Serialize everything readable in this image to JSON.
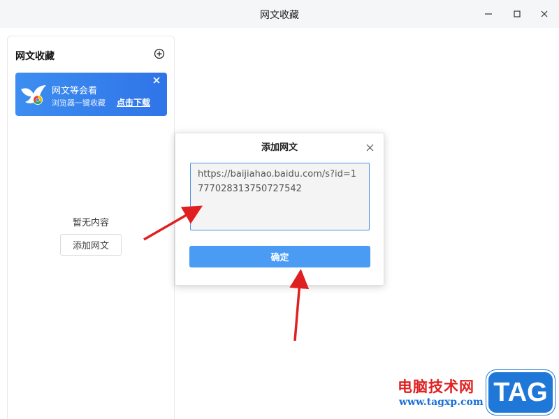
{
  "window": {
    "title": "网文收藏"
  },
  "sidebar": {
    "header": "网文收藏",
    "add_icon": "plus-circle-icon",
    "banner": {
      "title": "网文等会看",
      "subtitle": "浏览器一键收藏",
      "link": "点击下载"
    },
    "empty_text": "暂无内容",
    "add_button": "添加网文"
  },
  "dialog": {
    "title": "添加网文",
    "url_value": "https://baijiahao.baidu.com/s?id=1777028313750727542",
    "confirm_button": "确定"
  },
  "watermark": {
    "site_name": "电脑技术网",
    "url": "www.tagxp.com",
    "tag": "TAG"
  },
  "colors": {
    "primary": "#4a9bf3",
    "banner": "#2f74e8",
    "arrow": "#e02020"
  }
}
